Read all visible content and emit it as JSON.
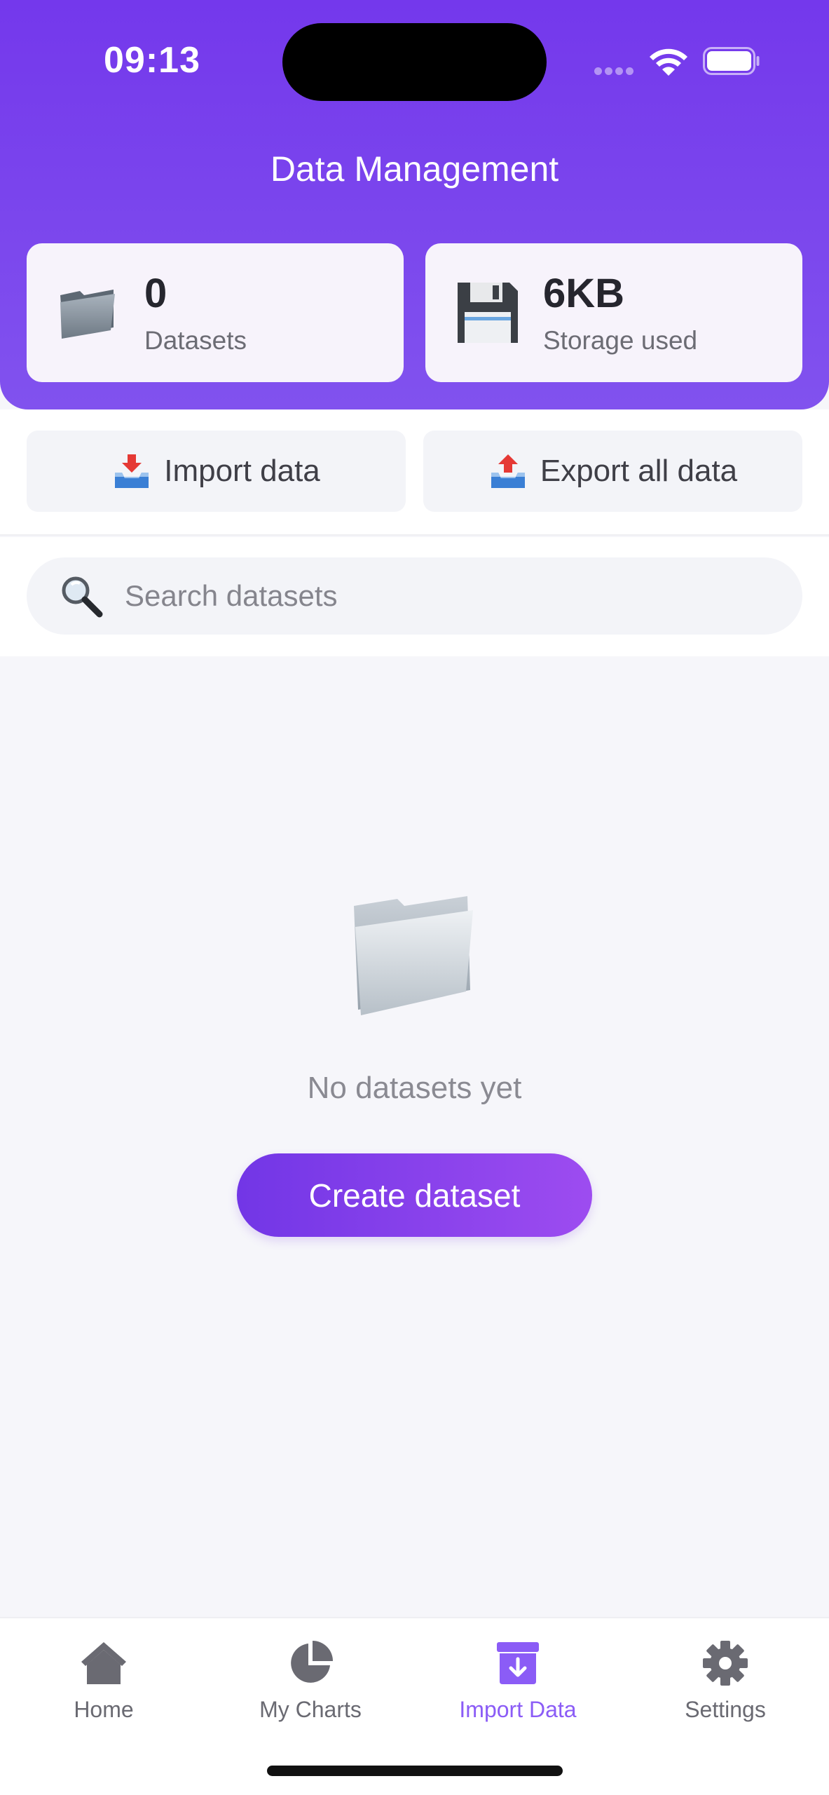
{
  "status_bar": {
    "time": "09:13",
    "icons": [
      "signal-icon",
      "wifi-icon",
      "battery-icon"
    ]
  },
  "header": {
    "title": "Data Management",
    "background_color": "#7438ec"
  },
  "stats": [
    {
      "icon": "folder-icon",
      "value": "0",
      "label": "Datasets"
    },
    {
      "icon": "floppy-disk-icon",
      "value": "6KB",
      "label": "Storage used"
    }
  ],
  "actions": {
    "import_label": "Import data",
    "import_icon": "inbox-tray-icon",
    "export_label": "Export all data",
    "export_icon": "outbox-tray-icon"
  },
  "search": {
    "placeholder": "Search datasets",
    "value": "",
    "icon": "magnifier-icon"
  },
  "empty_state": {
    "icon": "empty-folder-icon",
    "message": "No datasets yet",
    "button_label": "Create dataset",
    "button_color": "#7236e6"
  },
  "bottom_nav": {
    "items": [
      {
        "label": "Home",
        "icon": "home-icon",
        "active": false
      },
      {
        "label": "My Charts",
        "icon": "pie-chart-icon",
        "active": false
      },
      {
        "label": "Import Data",
        "icon": "import-box-icon",
        "active": true
      },
      {
        "label": "Settings",
        "icon": "gear-icon",
        "active": false
      }
    ],
    "active_color": "#8b5cf6",
    "inactive_color": "#6a6a72"
  }
}
